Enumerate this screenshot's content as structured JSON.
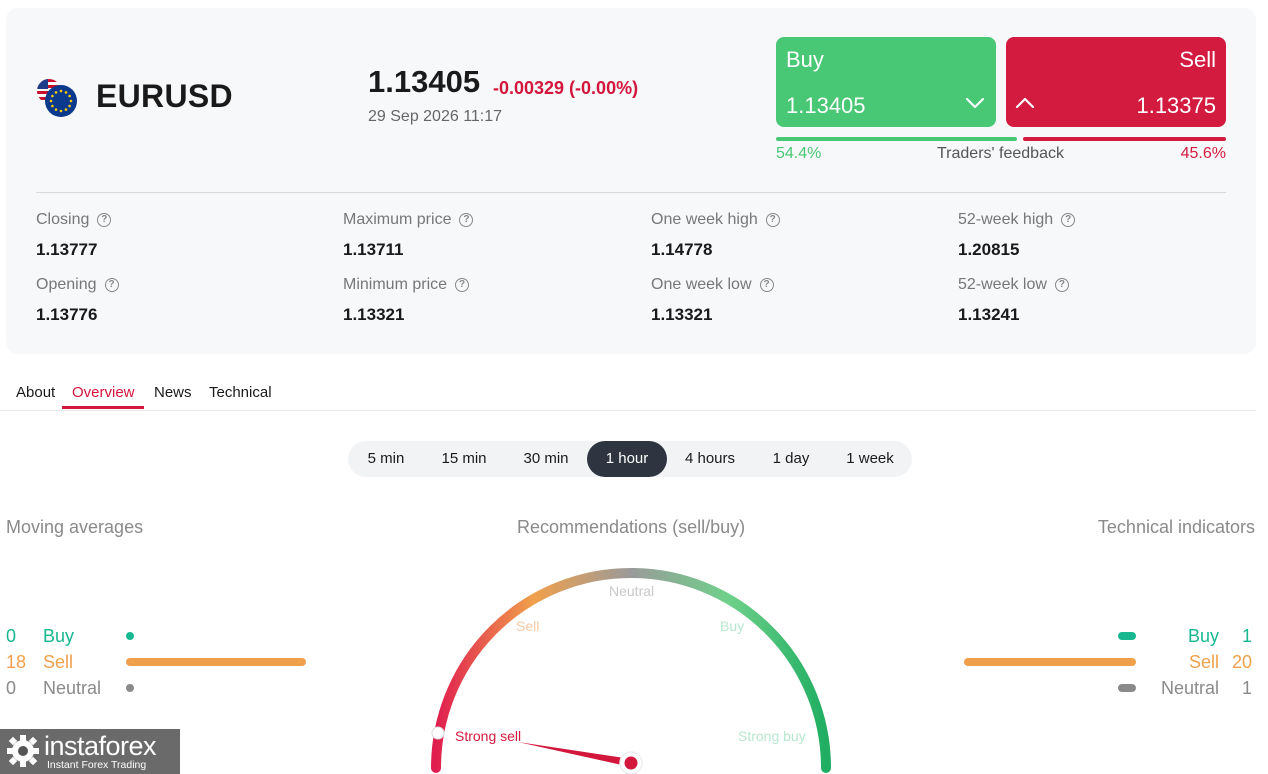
{
  "instrument": {
    "symbol": "EURUSD",
    "price": "1.13405",
    "change": "-0.00329 (-0.00%)",
    "datetime": "29 Sep 2026 11:17"
  },
  "trade": {
    "buy_label": "Buy",
    "buy_price": "1.13405",
    "sell_label": "Sell",
    "sell_price": "1.13375"
  },
  "feedback": {
    "buy_percent": "54.4%",
    "label": "Traders' feedback",
    "sell_percent": "45.6%",
    "buy_share": 0.544
  },
  "stats": [
    {
      "label": "Closing",
      "value": "1.13777"
    },
    {
      "label": "Maximum price",
      "value": "1.13711"
    },
    {
      "label": "One week high",
      "value": "1.14778"
    },
    {
      "label": "52-week high",
      "value": "1.20815"
    },
    {
      "label": "Opening",
      "value": "1.13776"
    },
    {
      "label": "Minimum price",
      "value": "1.13321"
    },
    {
      "label": "One week low",
      "value": "1.13321"
    },
    {
      "label": "52-week low",
      "value": "1.13241"
    }
  ],
  "tabs": [
    "About",
    "Overview",
    "News",
    "Technical"
  ],
  "active_tab": "Overview",
  "periods": [
    "5 min",
    "15 min",
    "30 min",
    "1 hour",
    "4 hours",
    "1 day",
    "1 week"
  ],
  "active_period": "1 hour",
  "moving_averages": {
    "title": "Moving averages",
    "rows": [
      {
        "count": "0",
        "label": "Buy",
        "color": "#17b890"
      },
      {
        "count": "18",
        "label": "Sell",
        "color": "#f0a04b"
      },
      {
        "count": "0",
        "label": "Neutral",
        "color": "#8a8a8a"
      }
    ]
  },
  "recommendations": {
    "title": "Recommendations (sell/buy)",
    "labels": {
      "strong_sell": "Strong sell",
      "sell": "Sell",
      "neutral": "Neutral",
      "buy": "Buy",
      "strong_buy": "Strong buy"
    }
  },
  "technical_indicators": {
    "title": "Technical indicators",
    "rows": [
      {
        "count": "1",
        "label": "Buy",
        "color": "#17b890"
      },
      {
        "count": "20",
        "label": "Sell",
        "color": "#f0a04b"
      },
      {
        "count": "1",
        "label": "Neutral",
        "color": "#8a8a8a"
      }
    ]
  },
  "colors": {
    "buy_green": "#48c774",
    "sell_red": "#d31a3f",
    "accent": "#d3163c",
    "indicator_buy": "#17b890",
    "indicator_sell": "#f0a04b",
    "indicator_neutral": "#8a8a8a"
  },
  "watermark": {
    "name": "instaforex",
    "tagline": "Instant Forex Trading"
  }
}
